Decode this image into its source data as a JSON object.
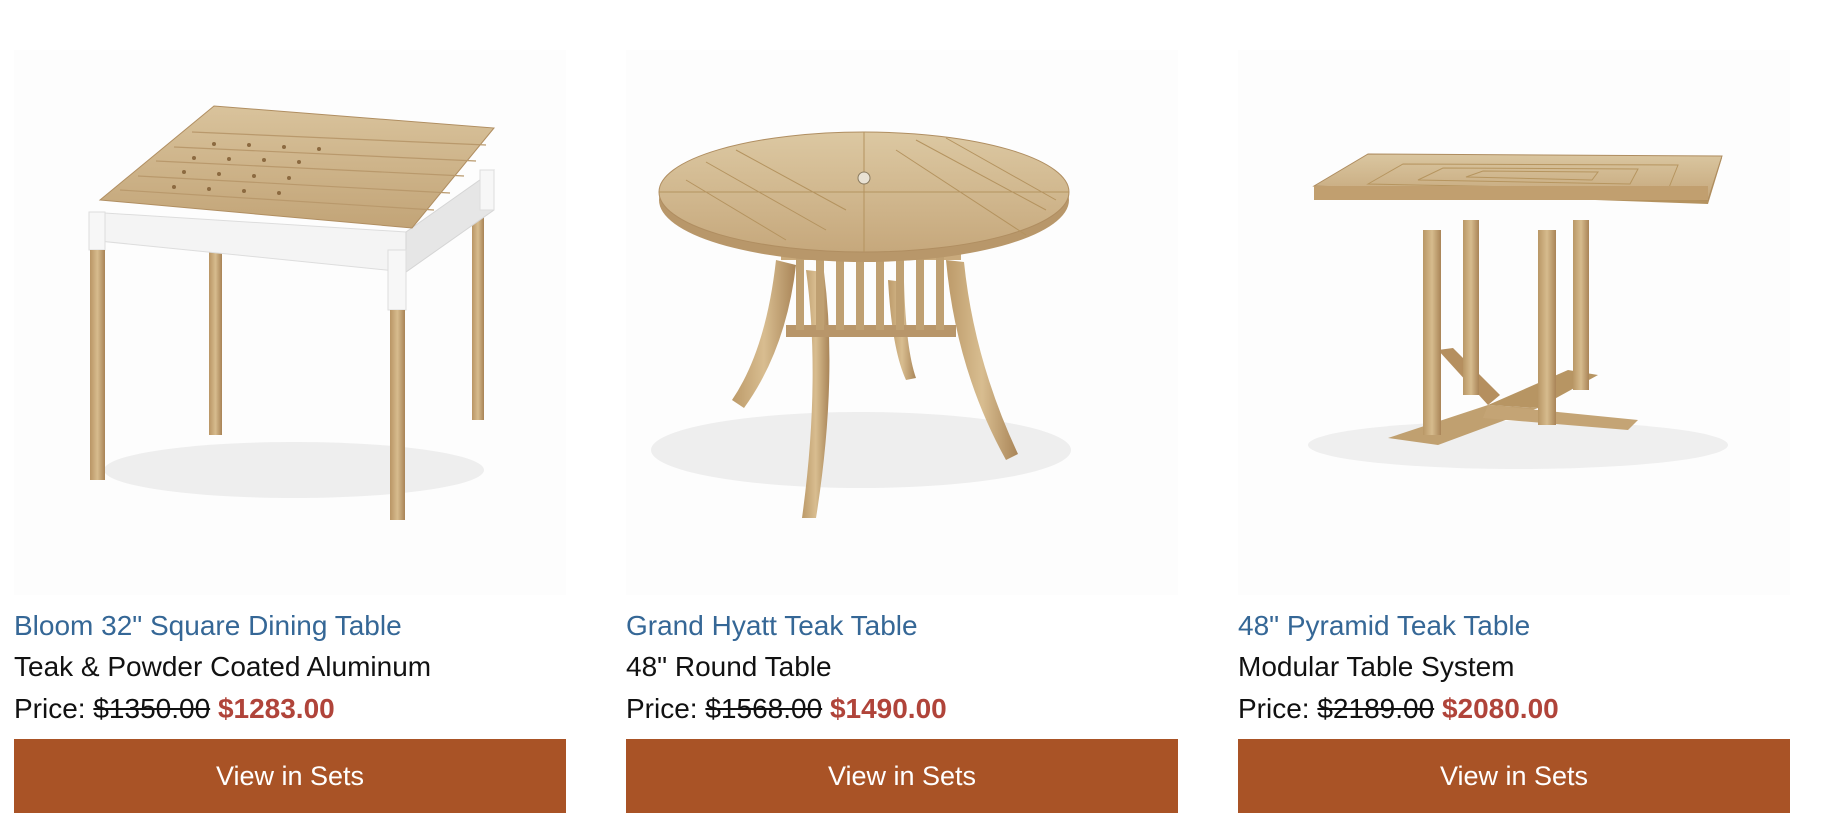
{
  "colors": {
    "link": "#356796",
    "sale_price": "#b0443a",
    "button_bg": "#a95326",
    "button_text": "#ffffff",
    "teak": "#c7a87a"
  },
  "products": [
    {
      "title": "Bloom 32\" Square Dining Table",
      "subtitle": "Teak & Powder Coated Aluminum",
      "price_label": "Price:",
      "old_price": "$1350.00",
      "new_price": "$1283.00",
      "button_label": "View in Sets"
    },
    {
      "title": "Grand Hyatt Teak Table",
      "subtitle": "48\" Round Table",
      "price_label": "Price:",
      "old_price": "$1568.00",
      "new_price": "$1490.00",
      "button_label": "View in Sets"
    },
    {
      "title": "48\" Pyramid Teak Table",
      "subtitle": "Modular Table System",
      "price_label": "Price:",
      "old_price": "$2189.00",
      "new_price": "$2080.00",
      "button_label": "View in Sets"
    }
  ]
}
